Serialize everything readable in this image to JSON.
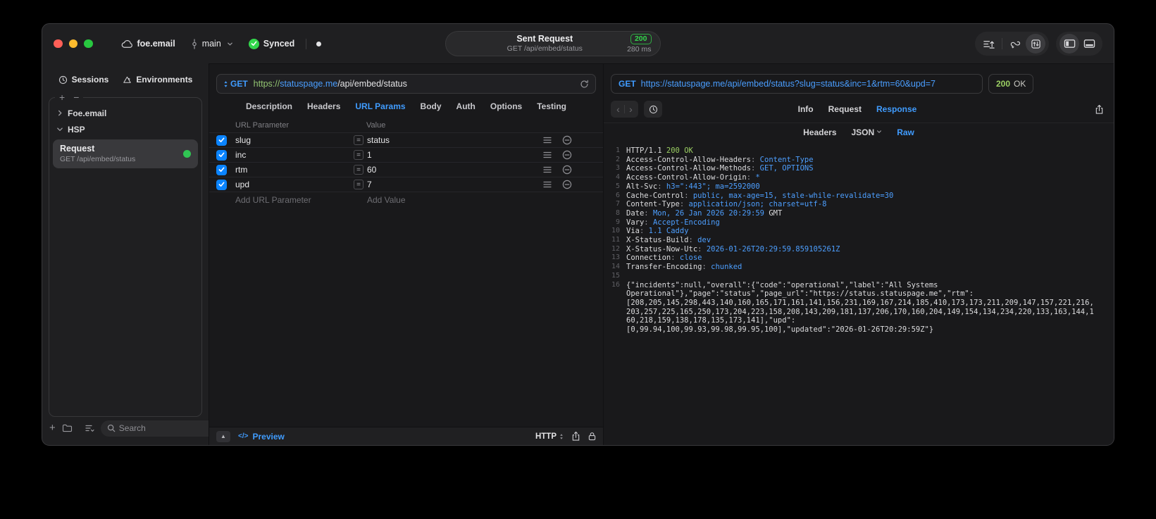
{
  "colors": {
    "accent": "#409cff",
    "green": "#32d74b",
    "code-green": "#9bcf63",
    "code-blue": "#4d9fff",
    "cb-blue": "#0a84ff",
    "scheme-green": "#93c572"
  },
  "titlebar": {
    "project": "foe.email",
    "branch": "main",
    "sync_label": "Synced",
    "sent_request": {
      "title": "Sent Request",
      "subtitle": "GET /api/embed/status",
      "status_code": "200",
      "duration": "280 ms"
    }
  },
  "sidebar": {
    "tabs": [
      {
        "label": "Sessions"
      },
      {
        "label": "Environments"
      }
    ],
    "tree": [
      {
        "label": "Foe.email",
        "expanded": false
      },
      {
        "label": "HSP",
        "expanded": true
      }
    ],
    "request_item": {
      "title": "Request",
      "subtitle": "GET /api/embed/status"
    },
    "search_placeholder": "Search"
  },
  "request_panel": {
    "method": "GET",
    "url": {
      "scheme": "https://",
      "host": "statuspage.me",
      "path": "/api/embed/status"
    },
    "tabs": [
      {
        "label": "Description"
      },
      {
        "label": "Headers"
      },
      {
        "label": "URL Params",
        "active": true
      },
      {
        "label": "Body"
      },
      {
        "label": "Auth"
      },
      {
        "label": "Options"
      },
      {
        "label": "Testing"
      }
    ],
    "params_table": {
      "columns": [
        "URL Parameter",
        "Value"
      ],
      "equals_glyph": "=",
      "rows": [
        {
          "key": "slug",
          "value": "status",
          "enabled": true
        },
        {
          "key": "inc",
          "value": "1",
          "enabled": true
        },
        {
          "key": "rtm",
          "value": "60",
          "enabled": true
        },
        {
          "key": "upd",
          "value": "7",
          "enabled": true
        }
      ],
      "add_key_placeholder": "Add URL Parameter",
      "add_value_placeholder": "Add Value"
    },
    "footer": {
      "preview_icon": "</>",
      "preview_label": "Preview",
      "protocol": "HTTP"
    }
  },
  "response_panel": {
    "request_line": {
      "method": "GET",
      "url": "https://statuspage.me/api/embed/status?slug=status&inc=1&rtm=60&upd=7"
    },
    "status": {
      "code": "200",
      "text": "OK"
    },
    "tabs": [
      {
        "label": "Info"
      },
      {
        "label": "Request"
      },
      {
        "label": "Response",
        "active": true
      }
    ],
    "view_tabs": [
      {
        "label": "Headers"
      },
      {
        "label": "JSON",
        "chevron": true
      },
      {
        "label": "Raw",
        "active": true
      }
    ],
    "body_lines": [
      {
        "num": "1",
        "segments": [
          {
            "t": "HTTP/1.1 ",
            "c": "plain"
          },
          {
            "t": "200 OK",
            "c": "green"
          }
        ]
      },
      {
        "num": "2",
        "segments": [
          {
            "t": "Access-Control-Allow-Headers",
            "c": "plain"
          },
          {
            "t": ": ",
            "c": "dim"
          },
          {
            "t": "Content-Type",
            "c": "blue"
          }
        ]
      },
      {
        "num": "3",
        "segments": [
          {
            "t": "Access-Control-Allow-Methods",
            "c": "plain"
          },
          {
            "t": ": ",
            "c": "dim"
          },
          {
            "t": "GET, OPTIONS",
            "c": "blue"
          }
        ]
      },
      {
        "num": "4",
        "segments": [
          {
            "t": "Access-Control-Allow-Origin",
            "c": "plain"
          },
          {
            "t": ": ",
            "c": "dim"
          },
          {
            "t": "*",
            "c": "blue"
          }
        ]
      },
      {
        "num": "5",
        "segments": [
          {
            "t": "Alt-Svc",
            "c": "plain"
          },
          {
            "t": ": ",
            "c": "dim"
          },
          {
            "t": "h3=\":443\"; ma=2592000",
            "c": "blue"
          }
        ]
      },
      {
        "num": "6",
        "segments": [
          {
            "t": "Cache-Control",
            "c": "plain"
          },
          {
            "t": ": ",
            "c": "dim"
          },
          {
            "t": "public, max-age=15, stale-while-revalidate=30",
            "c": "blue"
          }
        ]
      },
      {
        "num": "7",
        "segments": [
          {
            "t": "Content-Type",
            "c": "plain"
          },
          {
            "t": ": ",
            "c": "dim"
          },
          {
            "t": "application/json; charset=utf-8",
            "c": "blue"
          }
        ]
      },
      {
        "num": "8",
        "segments": [
          {
            "t": "Date",
            "c": "plain"
          },
          {
            "t": ": ",
            "c": "dim"
          },
          {
            "t": "Mon, 26 Jan 2026 20:29:59",
            "c": "blue"
          },
          {
            "t": " GMT",
            "c": "plain"
          }
        ]
      },
      {
        "num": "9",
        "segments": [
          {
            "t": "Vary",
            "c": "plain"
          },
          {
            "t": ": ",
            "c": "dim"
          },
          {
            "t": "Accept-Encoding",
            "c": "blue"
          }
        ]
      },
      {
        "num": "10",
        "segments": [
          {
            "t": "Via",
            "c": "plain"
          },
          {
            "t": ": ",
            "c": "dim"
          },
          {
            "t": "1.1 Caddy",
            "c": "blue"
          }
        ]
      },
      {
        "num": "11",
        "segments": [
          {
            "t": "X-Status-Build",
            "c": "plain"
          },
          {
            "t": ": ",
            "c": "dim"
          },
          {
            "t": "dev",
            "c": "blue"
          }
        ]
      },
      {
        "num": "12",
        "segments": [
          {
            "t": "X-Status-Now-Utc",
            "c": "plain"
          },
          {
            "t": ": ",
            "c": "dim"
          },
          {
            "t": "2026-01-26T20:29:59.859105261Z",
            "c": "blue"
          }
        ]
      },
      {
        "num": "13",
        "segments": [
          {
            "t": "Connection",
            "c": "plain"
          },
          {
            "t": ": ",
            "c": "dim"
          },
          {
            "t": "close",
            "c": "blue"
          }
        ]
      },
      {
        "num": "14",
        "segments": [
          {
            "t": "Transfer-Encoding",
            "c": "plain"
          },
          {
            "t": ": ",
            "c": "dim"
          },
          {
            "t": "chunked",
            "c": "blue"
          }
        ]
      },
      {
        "num": "15",
        "segments": []
      },
      {
        "num": "16",
        "segments": [
          {
            "t": "{\"incidents\":null,\"overall\":{\"code\":\"operational\",\"label\":\"All Systems",
            "c": "plain"
          }
        ]
      },
      {
        "num": "",
        "segments": [
          {
            "t": "Operational\"},\"page\":\"status\",\"page_url\":\"https://status.statuspage.me\",\"rtm\":",
            "c": "plain"
          }
        ]
      },
      {
        "num": "",
        "segments": [
          {
            "t": "[208,205,145,298,443,140,160,165,171,161,141,156,231,169,167,214,185,410,173,173,211,209,147,157,221,216,",
            "c": "plain"
          }
        ]
      },
      {
        "num": "",
        "segments": [
          {
            "t": "203,257,225,165,250,173,204,223,158,208,143,209,181,137,206,170,160,204,149,154,134,234,220,133,163,144,1",
            "c": "plain"
          }
        ]
      },
      {
        "num": "",
        "segments": [
          {
            "t": "60,218,159,138,178,135,173,141],\"upd\":",
            "c": "plain"
          }
        ]
      },
      {
        "num": "",
        "segments": [
          {
            "t": "[0,99.94,100,99.93,99.98,99.95,100],\"updated\":\"2026-01-26T20:29:59Z\"}",
            "c": "plain"
          }
        ]
      }
    ]
  }
}
